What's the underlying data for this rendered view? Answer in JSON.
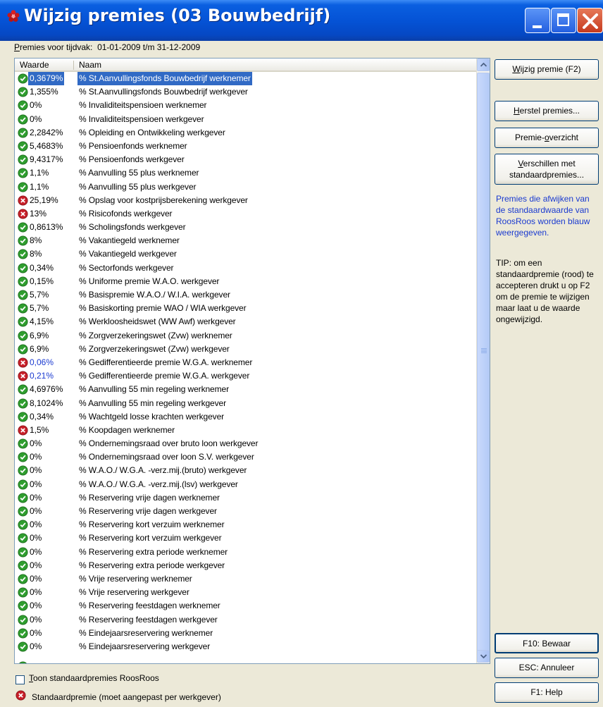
{
  "window": {
    "title": "Wijzig premies (03 Bouwbedrijf)"
  },
  "period": {
    "label_underlined": "P",
    "label_rest": "remies voor tijdvak:",
    "value": "01-01-2009 t/m 31-12-2009"
  },
  "table": {
    "columns": [
      "Waarde",
      "Naam"
    ],
    "rows": [
      {
        "status": "ok",
        "waarde": "0,3679%",
        "naam": "% St.Aanvullingsfonds Bouwbedrijf werknemer",
        "selected": true
      },
      {
        "status": "ok",
        "waarde": "1,355%",
        "naam": "% St.Aanvullingsfonds Bouwbedrijf werkgever"
      },
      {
        "status": "ok",
        "waarde": "0%",
        "naam": "% Invaliditeitspensioen werknemer"
      },
      {
        "status": "ok",
        "waarde": "0%",
        "naam": "% Invaliditeitspensioen werkgever"
      },
      {
        "status": "ok",
        "waarde": "2,2842%",
        "naam": "% Opleiding en Ontwikkeling werkgever"
      },
      {
        "status": "ok",
        "waarde": "5,4683%",
        "naam": "% Pensioenfonds werknemer"
      },
      {
        "status": "ok",
        "waarde": "9,4317%",
        "naam": "% Pensioenfonds werkgever"
      },
      {
        "status": "ok",
        "waarde": "1,1%",
        "naam": "% Aanvulling 55 plus werknemer"
      },
      {
        "status": "ok",
        "waarde": "1,1%",
        "naam": "% Aanvulling 55 plus werkgever"
      },
      {
        "status": "err",
        "waarde": "25,19%",
        "naam": "% Opslag voor kostprijsberekening werkgever"
      },
      {
        "status": "err",
        "waarde": "13%",
        "naam": "% Risicofonds werkgever"
      },
      {
        "status": "ok",
        "waarde": "0,8613%",
        "naam": "% Scholingsfonds werkgever"
      },
      {
        "status": "ok",
        "waarde": "8%",
        "naam": "% Vakantiegeld werknemer"
      },
      {
        "status": "ok",
        "waarde": "8%",
        "naam": "% Vakantiegeld werkgever"
      },
      {
        "status": "ok",
        "waarde": "0,34%",
        "naam": "% Sectorfonds werkgever"
      },
      {
        "status": "ok",
        "waarde": "0,15%",
        "naam": "% Uniforme premie W.A.O. werkgever"
      },
      {
        "status": "ok",
        "waarde": "5,7%",
        "naam": "% Basispremie W.A.O./ W.I.A. werkgever"
      },
      {
        "status": "ok",
        "waarde": "5,7%",
        "naam": "% Basiskorting premie WAO / WIA werkgever"
      },
      {
        "status": "ok",
        "waarde": "4,15%",
        "naam": "% Werkloosheidswet (WW Awf) werkgever"
      },
      {
        "status": "ok",
        "waarde": "6,9%",
        "naam": "% Zorgverzekeringswet (Zvw) werknemer"
      },
      {
        "status": "ok",
        "waarde": "6,9%",
        "naam": "% Zorgverzekeringswet (Zvw) werkgever"
      },
      {
        "status": "err",
        "waarde": "0,06%",
        "naam": "% Gedifferentieerde premie W.G.A. werknemer",
        "blue": true
      },
      {
        "status": "err",
        "waarde": "0,21%",
        "naam": "% Gedifferentieerde premie W.G.A. werkgever",
        "blue": true
      },
      {
        "status": "ok",
        "waarde": "4,6976%",
        "naam": "% Aanvulling 55 min regeling werknemer"
      },
      {
        "status": "ok",
        "waarde": "8,1024%",
        "naam": "% Aanvulling 55 min regeling werkgever"
      },
      {
        "status": "ok",
        "waarde": "0,34%",
        "naam": "% Wachtgeld losse krachten werkgever"
      },
      {
        "status": "err",
        "waarde": "1,5%",
        "naam": "% Koopdagen werknemer"
      },
      {
        "status": "ok",
        "waarde": "0%",
        "naam": "% Ondernemingsraad over bruto loon werkgever"
      },
      {
        "status": "ok",
        "waarde": "0%",
        "naam": "% Ondernemingsraad over loon S.V. werkgever"
      },
      {
        "status": "ok",
        "waarde": "0%",
        "naam": "% W.A.O./ W.G.A. -verz.mij.(bruto) werkgever"
      },
      {
        "status": "ok",
        "waarde": "0%",
        "naam": "% W.A.O./ W.G.A. -verz.mij.(lsv) werkgever"
      },
      {
        "status": "ok",
        "waarde": "0%",
        "naam": "% Reservering vrije dagen werknemer"
      },
      {
        "status": "ok",
        "waarde": "0%",
        "naam": "% Reservering vrije dagen werkgever"
      },
      {
        "status": "ok",
        "waarde": "0%",
        "naam": "% Reservering kort verzuim werknemer"
      },
      {
        "status": "ok",
        "waarde": "0%",
        "naam": "% Reservering kort verzuim werkgever"
      },
      {
        "status": "ok",
        "waarde": "0%",
        "naam": "% Reservering extra periode werknemer"
      },
      {
        "status": "ok",
        "waarde": "0%",
        "naam": "% Reservering extra periode werkgever"
      },
      {
        "status": "ok",
        "waarde": "0%",
        "naam": "% Vrije reservering werknemer"
      },
      {
        "status": "ok",
        "waarde": "0%",
        "naam": "% Vrije reservering werkgever"
      },
      {
        "status": "ok",
        "waarde": "0%",
        "naam": "% Reservering feestdagen werknemer"
      },
      {
        "status": "ok",
        "waarde": "0%",
        "naam": "% Reservering feestdagen werkgever"
      },
      {
        "status": "ok",
        "waarde": "0%",
        "naam": "% Eindejaarsreservering werknemer"
      },
      {
        "status": "ok",
        "waarde": "0%",
        "naam": "% Eindejaarsreservering werkgever"
      }
    ]
  },
  "checkbox": {
    "underlined": "T",
    "rest": "oon standaardpremies RoosRoos",
    "checked": false
  },
  "legend": {
    "label": "Standaardpremie (moet aangepast per werkgever)"
  },
  "buttons": {
    "wijzig": {
      "u": "W",
      "rest": "ijzig premie (F2)"
    },
    "herstel": {
      "u": "H",
      "rest": "erstel premies..."
    },
    "overzicht": {
      "pre": "Premie-",
      "u": "o",
      "rest": "verzicht"
    },
    "verschillen": {
      "u": "V",
      "line1_rest": "erschillen met",
      "line2": "standaardpremies..."
    },
    "bewaar": "F10: Bewaar",
    "annuleer": "ESC: Annuleer",
    "help": "F1: Help"
  },
  "info": {
    "blue_text": "Premies die afwijken van de standaardwaarde van RoosRoos worden blauw weergegeven.",
    "tip_text": "TIP: om een standaardpremie (rood) te accepteren drukt u op F2 om de premie te wijzigen maar laat u de waarde ongewijzigd."
  },
  "colors": {
    "ok_icon": "#2f9e2f",
    "err_icon": "#c8202a",
    "selection": "#316AC5",
    "deviating_value": "#1a3ad0"
  },
  "icons": {
    "ok": "check-circle-icon",
    "err": "x-circle-icon"
  }
}
